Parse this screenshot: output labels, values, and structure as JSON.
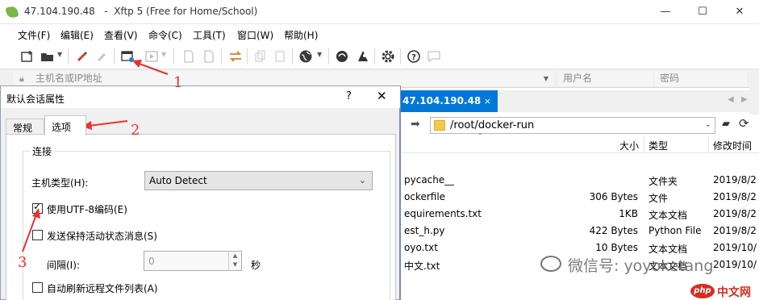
{
  "window": {
    "host": "47.104.190.48",
    "app_title": "Xftp 5 (Free for Home/School)",
    "minimize": "—",
    "maximize": "☐",
    "close": "✕"
  },
  "menu": [
    {
      "label": "文件(F)"
    },
    {
      "label": "编辑(E)"
    },
    {
      "label": "查看(V)"
    },
    {
      "label": "命令(C)"
    },
    {
      "label": "工具(T)"
    },
    {
      "label": "窗口(W)"
    },
    {
      "label": "帮助(H)"
    }
  ],
  "addressbar": {
    "host_placeholder": "主机名或IP地址",
    "username_placeholder": "用户名",
    "password_placeholder": "密码"
  },
  "session_tab": {
    "label": "47.104.190.48",
    "close": "×"
  },
  "path": "/root/docker-run",
  "file_list": {
    "headers": [
      "大小",
      "类型",
      "修改时间"
    ],
    "rows": [
      {
        "name": "pycache__",
        "size": "",
        "type": "文件夹",
        "modified": "2019/8/2"
      },
      {
        "name": "ockerfile",
        "size": "306 Bytes",
        "type": "文件",
        "modified": "2019/8/2"
      },
      {
        "name": "equirements.txt",
        "size": "1KB",
        "type": "文本文档",
        "modified": "2019/8/2"
      },
      {
        "name": "est_h.py",
        "size": "422 Bytes",
        "type": "Python File",
        "modified": "2019/8/2"
      },
      {
        "name": "oyo.txt",
        "size": "10 Bytes",
        "type": "文本文档",
        "modified": "2019/10/"
      },
      {
        "name": "中文.txt",
        "size": "",
        "type": "文本文档",
        "modified": "2019/10/"
      }
    ]
  },
  "dialog": {
    "title": "默认会话属性",
    "help": "?",
    "close": "✕",
    "tabs": [
      {
        "label": "常规"
      },
      {
        "label": "选项"
      }
    ],
    "group_title": "连接",
    "host_type_label": "主机类型(H):",
    "host_type_value": "Auto Detect",
    "utf8_label": "使用UTF-8编码(E)",
    "utf8_checked": true,
    "keepalive_label": "发送保持活动状态消息(S)",
    "keepalive_checked": false,
    "interval_label": "间隔(I):",
    "interval_value": "0",
    "interval_unit": "秒",
    "autorefresh_label": "自动刷新远程文件列表(A)",
    "autorefresh_checked": false
  },
  "annotations": {
    "a1": "1",
    "a2": "2",
    "a3": "3"
  },
  "watermark": {
    "text": "微信号: yoyoketang",
    "site": "中文网",
    "site_logo": "php"
  },
  "colors": {
    "accent": "#0078d7",
    "annotation": "#e8322c",
    "php_red": "#d82c20"
  }
}
